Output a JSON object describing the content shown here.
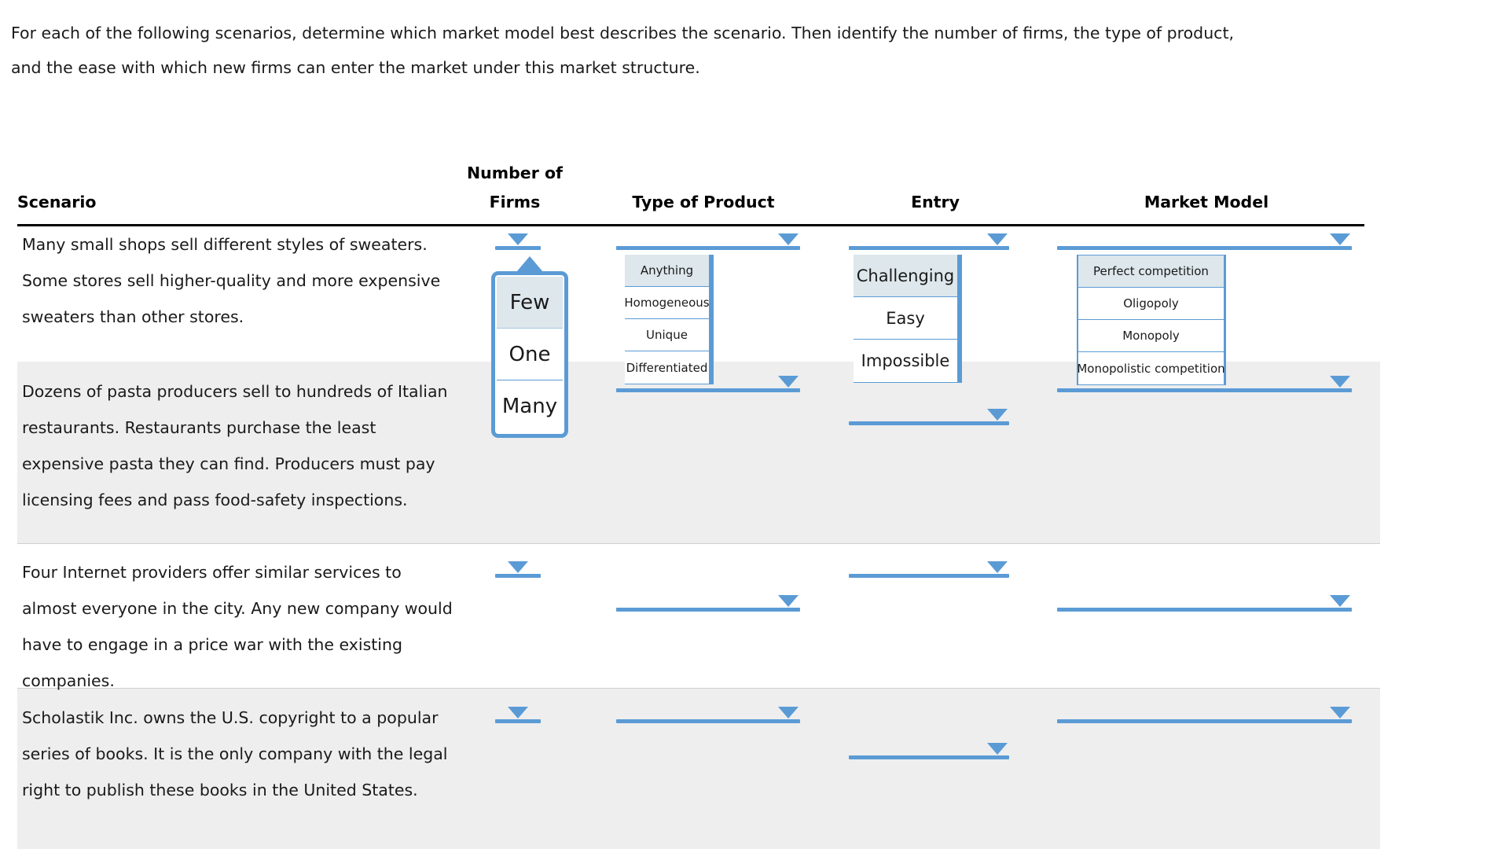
{
  "prompt": {
    "line1": "For each of the following scenarios, determine which market model best describes the scenario. Then identify the number of firms, the type of product,",
    "line2": "and the ease with which new firms can enter the market under this market structure."
  },
  "table": {
    "headers": {
      "scenario": "Scenario",
      "firms_line1": "Number of",
      "firms_line2": "Firms",
      "product": "Type of Product",
      "entry": "Entry",
      "model": "Market Model"
    },
    "rows": [
      {
        "scenario": "Many small shops sell different styles of sweaters. Some stores sell higher-quality and more expensive sweaters than other stores.",
        "firms": "",
        "product": "",
        "entry": "",
        "model": "",
        "shaded": false
      },
      {
        "scenario": "Dozens of pasta producers sell to hundreds of Italian restaurants. Restaurants purchase the least expensive pasta they can find. Producers must pay licensing fees and pass food-safety inspections.",
        "firms": "",
        "product": "",
        "entry": "",
        "model": "",
        "shaded": true
      },
      {
        "scenario": "Four Internet providers offer similar services to almost everyone in the city. Any new company would have to engage in a price war with the existing companies.",
        "firms": "",
        "product": "",
        "entry": "",
        "model": "",
        "shaded": false
      },
      {
        "scenario": "Scholastik Inc. owns the U.S. copyright to a popular series of books. It is the only company with the legal right to publish these books in the United States.",
        "firms": "",
        "product": "",
        "entry": "",
        "model": "",
        "shaded": true
      }
    ]
  },
  "dropdowns": {
    "firms": {
      "open": true,
      "options": [
        "Few",
        "One",
        "Many"
      ],
      "highlighted": "Few"
    },
    "product": {
      "open": true,
      "options": [
        "Anything",
        "Homogeneous",
        "Unique",
        "Differentiated"
      ],
      "highlighted": "Anything"
    },
    "entry": {
      "open": true,
      "options": [
        "Challenging",
        "Easy",
        "Impossible"
      ],
      "highlighted": "Challenging"
    },
    "model": {
      "open": true,
      "options": [
        "Perfect competition",
        "Oligopoly",
        "Monopoly",
        "Monopolistic competition"
      ],
      "highlighted": "Perfect competition"
    }
  },
  "colors": {
    "accent_blue": "#5b9bd5",
    "highlight_fill": "#dde7ec",
    "row_shade": "#eeeeee",
    "rule": "#000000"
  },
  "icons": {
    "caret": "chevron-down-icon",
    "pointer": "menu-pointer-up-icon"
  }
}
